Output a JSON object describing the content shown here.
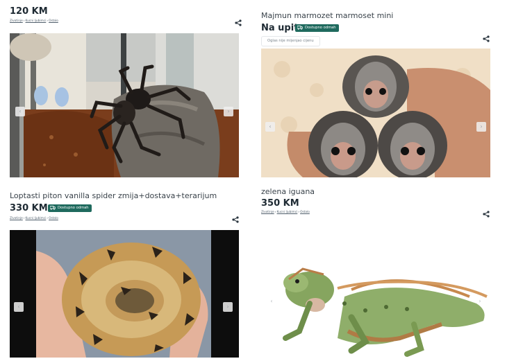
{
  "listings": [
    {
      "title": "",
      "price": "120 KM",
      "badge": "",
      "breadcrumb": [
        "Zivotinje",
        "Kucni ljubimci",
        "Ostalo"
      ],
      "photo_subject": "tarantula-photo"
    },
    {
      "title": "Majmun marmozet marmoset mini",
      "price": "Na upit",
      "badge": "Dostupno odmah",
      "note_chip": "Oglas nije mijenjao cijenu",
      "photo_subject": "marmoset-photo"
    },
    {
      "title": "Loptasti piton vanilla spider zmija+dostava+terarijum",
      "price": "330 KM",
      "badge": "Dostupno odmah",
      "breadcrumb": [
        "Zivotinje",
        "Kucni ljubimci",
        "Ostalo"
      ],
      "photo_subject": "ball-python-photo"
    },
    {
      "title": "zelena iguana",
      "price": "350 KM",
      "badge": "",
      "breadcrumb": [
        "Zivotinje",
        "Kucni ljubimci",
        "Ostalo"
      ],
      "photo_subject": "iguana-photo"
    }
  ],
  "icons": {
    "share": "share-icon",
    "prev": "chevron-left-icon",
    "next": "chevron-right-icon",
    "truck": "truck-icon"
  },
  "glyphs": {
    "prev": "‹",
    "next": "›",
    "sep": "›"
  },
  "colors": {
    "badge_bg": "#1f6a5e",
    "price": "#1e2a33",
    "breadcrumb": "#4e5d6a"
  }
}
